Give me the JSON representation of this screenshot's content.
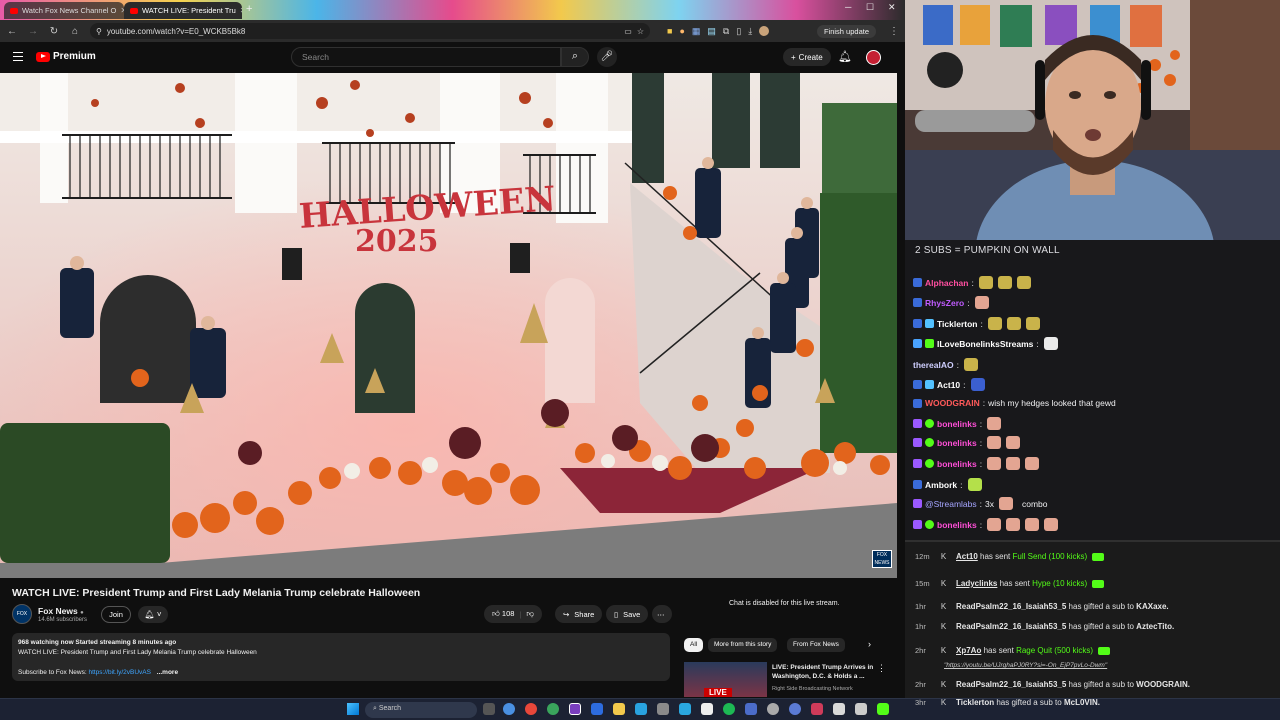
{
  "browser": {
    "tabs": [
      {
        "label": "Watch Fox News Channel O"
      },
      {
        "label": "WATCH LIVE: President Tru"
      }
    ],
    "url": "youtube.com/watch?v=E0_WCKB5Bk8",
    "finish_update": "Finish update"
  },
  "youtube": {
    "brand": "Premium",
    "search_placeholder": "Search",
    "create_label": "Create",
    "video": {
      "title": "WATCH LIVE: President Trump and First Lady Melania Trump celebrate Halloween",
      "sign_text": "HALLOWEEN",
      "sign_year": "2025",
      "channel_bug": "FOX NEWS"
    },
    "channel": {
      "name": "Fox News",
      "subscribers": "14.6M subscribers",
      "join_label": "Join"
    },
    "actions": {
      "likes": "108",
      "share": "Share",
      "save": "Save"
    },
    "description": {
      "stats": "968 watching now  Started streaming 8 minutes ago",
      "line1": "WATCH LIVE: President Trump and First Lady Melania Trump celebrate Halloween",
      "subscribe_prefix": "Subscribe to Fox News: ",
      "subscribe_link": "https://bit.ly/2vBUvAS",
      "more": "...more"
    },
    "chat_disabled": "Chat is disabled for this live stream.",
    "chips": [
      "All",
      "More from this story",
      "From Fox News"
    ],
    "recommended": {
      "title": "LIVE: President Trump Arrives in Washington, D.C. & Holds a ...",
      "channel": "Right Side Broadcasting Network",
      "badge": "LIVE"
    }
  },
  "taskbar": {
    "search_placeholder": "Search"
  },
  "chat": {
    "banner": "2 SUBS = PUMPKIN ON WALL",
    "messages": [
      {
        "user": "Alphachan",
        "text": "",
        "color": "#ff4fa0"
      },
      {
        "user": "RhysZero",
        "text": "",
        "color": "#c05bff"
      },
      {
        "user": "Ticklerton",
        "text": "",
        "color": "#ffffff"
      },
      {
        "user": "ILoveBonelinksStreams",
        "text": "",
        "color": "#ffffff"
      },
      {
        "user": "therealAO",
        "text": "",
        "color": "#cfcfff"
      },
      {
        "user": "Act10",
        "text": "",
        "color": "#ffffff"
      },
      {
        "user": "WOODGRAIN",
        "text": "wish my hedges looked that gewd",
        "color": "#ff5a5a"
      },
      {
        "user": "bonelinks",
        "text": "",
        "color": "#ff4fd8"
      },
      {
        "user": "bonelinks",
        "text": "",
        "color": "#ff4fd8"
      },
      {
        "user": "bonelinks",
        "text": "",
        "color": "#ff4fd8"
      },
      {
        "user": "Ambork",
        "text": "",
        "color": "#ffffff"
      },
      {
        "user": "@Streamlabs",
        "text": "combo",
        "prefix": "3x",
        "color": "#a5a5ff"
      },
      {
        "user": "bonelinks",
        "text": "",
        "color": "#ff4fd8"
      }
    ]
  },
  "feed": {
    "events": [
      {
        "time": "12m",
        "user": "Act10",
        "action": "has sent",
        "item": "Full Send (100 kicks)"
      },
      {
        "time": "15m",
        "user": "Ladyclinks",
        "action": "has sent",
        "item": "Hype (10 kicks)"
      },
      {
        "time": "1hr",
        "user": "ReadPsalm22_16_Isaiah53_5",
        "action": "has gifted a sub to",
        "target": "KAXaxe."
      },
      {
        "time": "1hr",
        "user": "ReadPsalm22_16_Isaiah53_5",
        "action": "has gifted a sub to",
        "target": "AztecTito."
      },
      {
        "time": "2hr",
        "user": "Xp7Ao",
        "action": "has sent",
        "item": "Rage Quit (500 kicks)",
        "link": "\"https://youtu.be/UJrghaPJ0RY?si=-On_EjP7pvLo-Dwm\""
      },
      {
        "time": "2hr",
        "user": "ReadPsalm22_16_Isaiah53_5",
        "action": "has gifted a sub to",
        "target": "WOODGRAIN."
      },
      {
        "time": "3hr",
        "user": "Ticklerton",
        "action": "has gifted a sub to",
        "target": "McL0VIN."
      }
    ]
  },
  "colors": {
    "youtube_red": "#ff0000",
    "kick_green": "#53fc18",
    "chat_bg": "#18181b"
  }
}
